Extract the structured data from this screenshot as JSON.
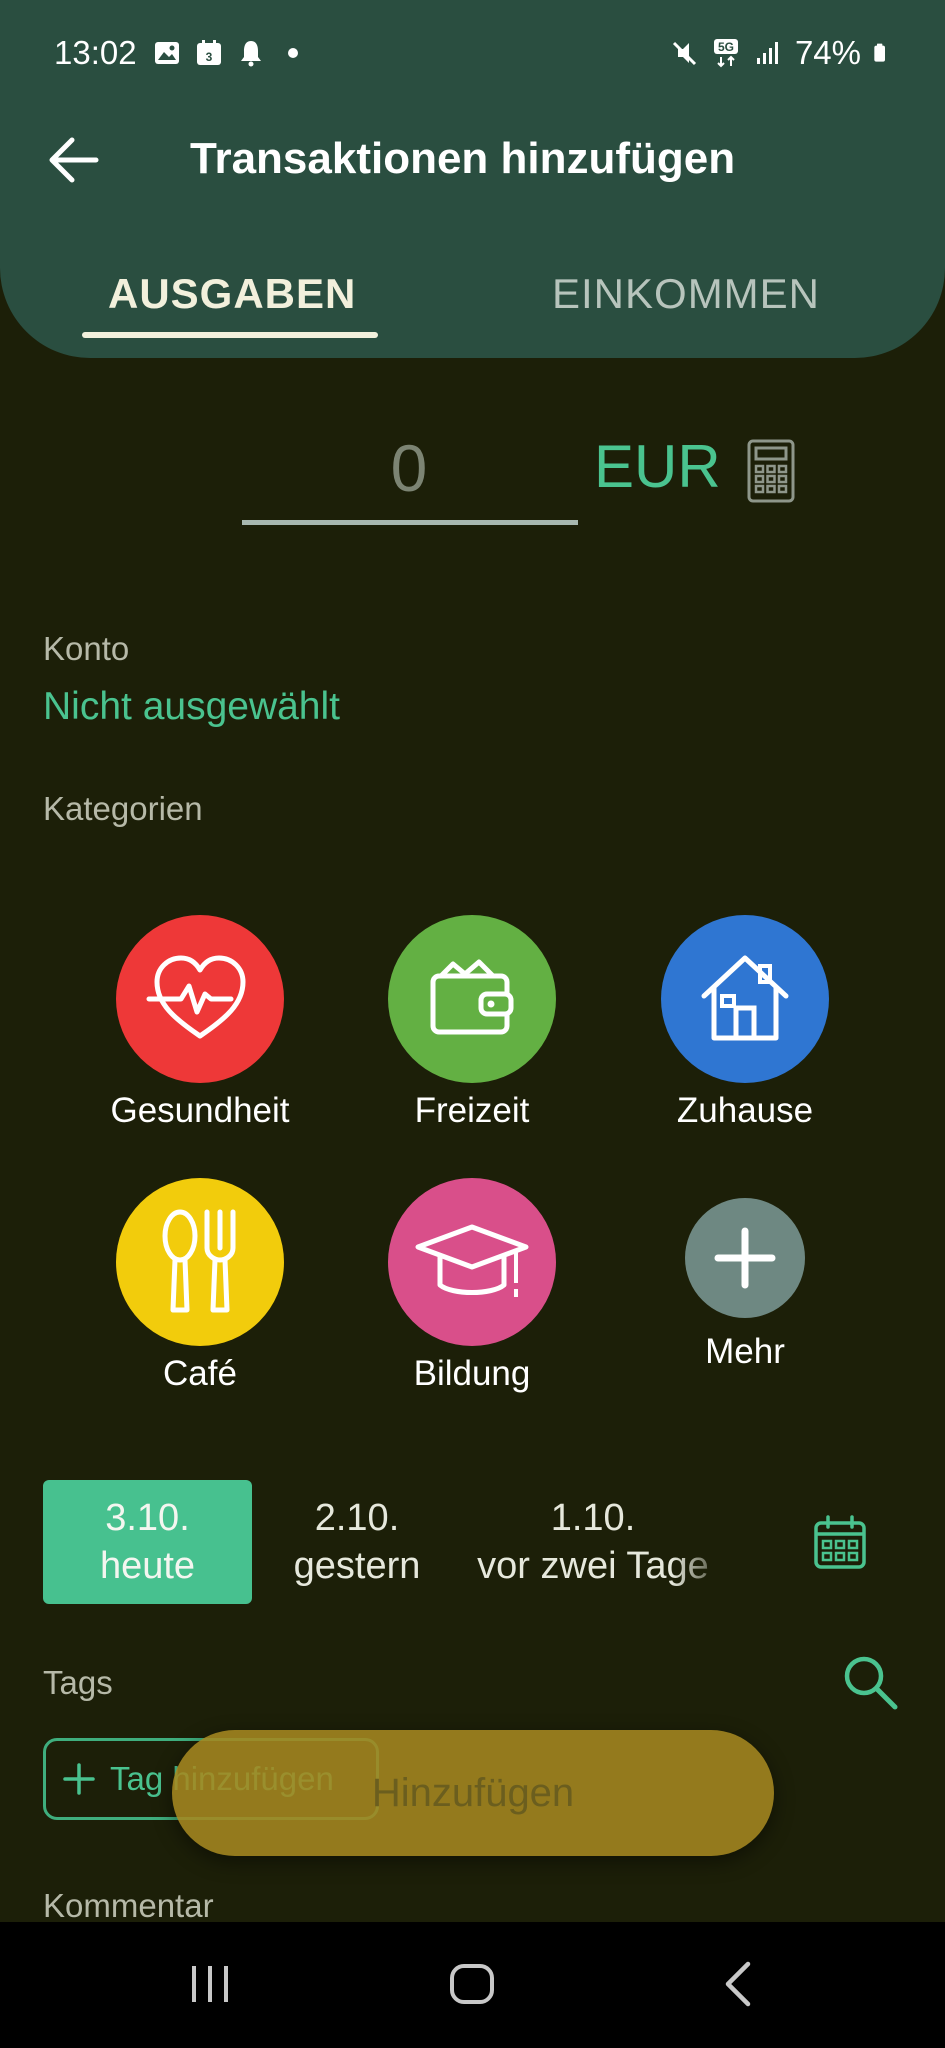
{
  "status_bar": {
    "time": "13:02",
    "battery": "74%",
    "network": "5G"
  },
  "header": {
    "title": "Transaktionen hinzufügen",
    "tabs": [
      {
        "label": "AUSGABEN",
        "active": true
      },
      {
        "label": "EINKOMMEN",
        "active": false
      }
    ]
  },
  "amount": {
    "value": "0",
    "currency": "EUR"
  },
  "account": {
    "label": "Konto",
    "value": "Nicht ausgewählt"
  },
  "categories": {
    "label": "Kategorien",
    "items": [
      {
        "label": "Gesundheit",
        "icon": "heart-pulse-icon",
        "color": "#ee3838"
      },
      {
        "label": "Freizeit",
        "icon": "wallet-icon",
        "color": "#63b043"
      },
      {
        "label": "Zuhause",
        "icon": "house-icon",
        "color": "#2f76d2"
      },
      {
        "label": "Café",
        "icon": "cutlery-icon",
        "color": "#f2cc0c"
      },
      {
        "label": "Bildung",
        "icon": "graduation-cap-icon",
        "color": "#d94f8a"
      },
      {
        "label": "Mehr",
        "icon": "plus-icon",
        "color": "#6e8882"
      }
    ]
  },
  "dates": [
    {
      "date": "3.10.",
      "caption": "heute",
      "selected": true
    },
    {
      "date": "2.10.",
      "caption": "gestern",
      "selected": false
    },
    {
      "date": "1.10.",
      "caption": "vor zwei Tage",
      "selected": false
    }
  ],
  "tags": {
    "label": "Tags",
    "add_label": "Tag hinzufügen"
  },
  "add_button": {
    "label": "Hinzufügen"
  },
  "comment": {
    "label": "Kommentar"
  },
  "colors": {
    "background": "#1c1f08",
    "header": "#2a4e40",
    "accent": "#4ac38f",
    "add_button": "#a58720"
  }
}
